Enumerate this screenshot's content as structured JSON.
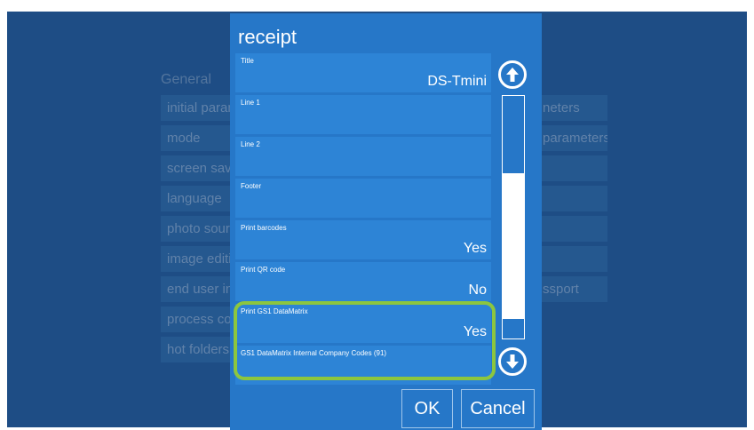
{
  "background": {
    "heading": "General",
    "left_items": [
      "initial param",
      "mode",
      "screen save",
      "language",
      "photo sourc",
      "image editi",
      "end user in",
      "process co",
      "hot folders"
    ],
    "right_items": [
      "neters",
      "parameters",
      "",
      "",
      "",
      "",
      "ssport"
    ]
  },
  "dialog": {
    "title": "receipt",
    "fields": [
      {
        "label": "Title",
        "value": "DS-Tmini"
      },
      {
        "label": "Line 1",
        "value": ""
      },
      {
        "label": "Line 2",
        "value": ""
      },
      {
        "label": "Footer",
        "value": ""
      },
      {
        "label": "Print barcodes",
        "value": "Yes"
      },
      {
        "label": "Print QR code",
        "value": "No"
      },
      {
        "label": "Print GS1 DataMatrix",
        "value": "Yes"
      },
      {
        "label": "GS1 DataMatrix Internal Company Codes (91)",
        "value": ""
      }
    ],
    "scroll_up_icon": "arrow-up-circle-icon",
    "scroll_down_icon": "arrow-down-circle-icon",
    "ok_label": "OK",
    "cancel_label": "Cancel"
  },
  "colors": {
    "background": "#1e4d85",
    "dialog": "#2677c8",
    "field": "#2d84d6",
    "highlight": "#8cc63f"
  }
}
